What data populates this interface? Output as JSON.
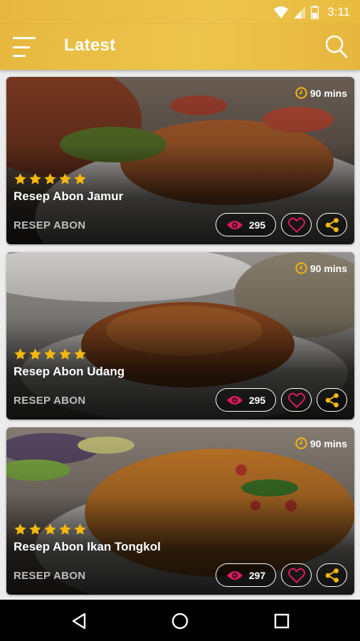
{
  "status_bar": {
    "time": "3:11",
    "icons": [
      "wifi-icon",
      "cell-signal-icon",
      "battery-icon"
    ]
  },
  "app_bar": {
    "title": "Latest",
    "icons": [
      "menu-icon",
      "search-icon"
    ]
  },
  "colors": {
    "primary": "#E9BC43",
    "accent_pink": "#D81B60",
    "star": "#F5B70C",
    "share": "#F5B70C"
  },
  "recipes": [
    {
      "title": "Resep Abon Jamur",
      "duration": "90 mins",
      "category": "RESEP ABON",
      "views": "295",
      "rating": 5
    },
    {
      "title": "Resep Abon Udang",
      "duration": "90 mins",
      "category": "RESEP ABON",
      "views": "295",
      "rating": 5
    },
    {
      "title": "Resep Abon Ikan Tongkol",
      "duration": "90 mins",
      "category": "RESEP ABON",
      "views": "297",
      "rating": 5
    }
  ],
  "nav_bar": {
    "icons": [
      "back-icon",
      "home-icon",
      "recents-icon"
    ]
  }
}
